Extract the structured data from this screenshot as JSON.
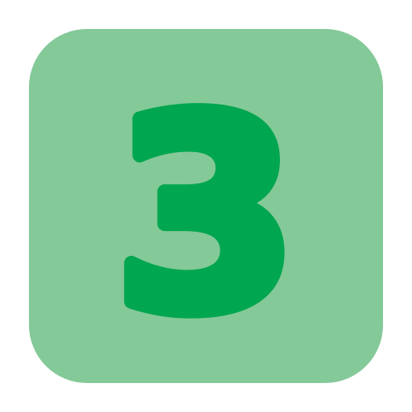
{
  "icon": {
    "digit": "3",
    "icon_name": "number-three-icon",
    "background_color": "#84c998",
    "digit_color": "#00a650"
  }
}
